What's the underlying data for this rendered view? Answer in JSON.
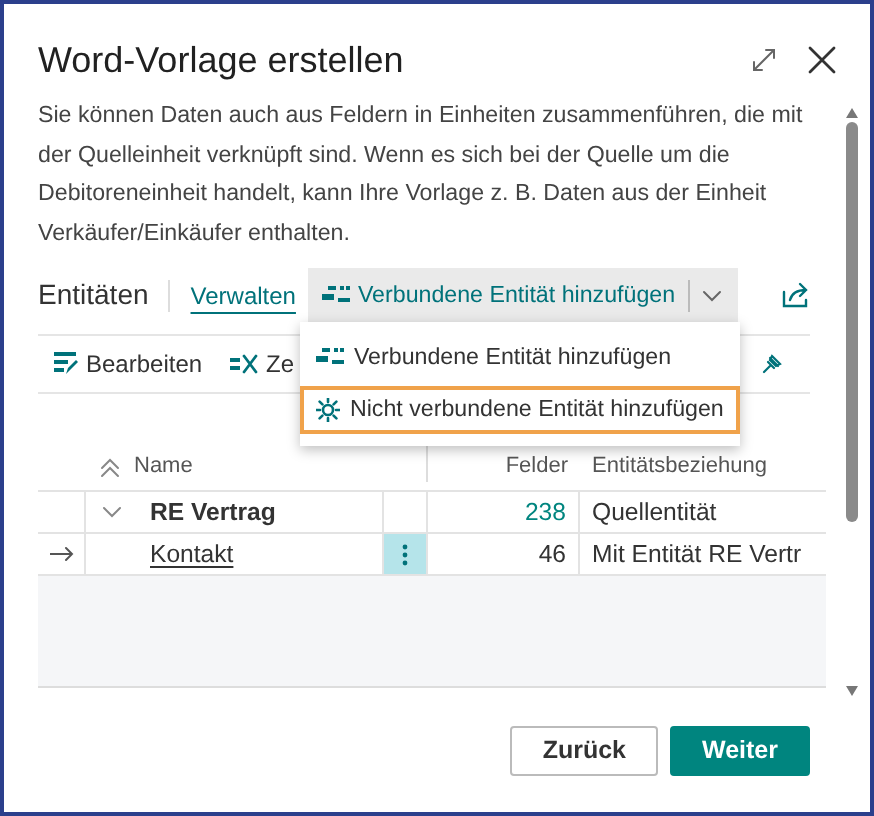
{
  "window": {
    "title": "Word-Vorlage erstellen"
  },
  "description": "Sie können Daten auch aus Feldern in Einheiten zusammenführen, die mit der Quelleinheit verknüpft sind. Wenn es sich bei der Quelle um die Debitoreneinheit handelt, kann Ihre Vorlage z. B. Daten aus der Einheit Verkäufer/Einkäufer enthalten.",
  "entities_bar": {
    "title": "Entitäten",
    "tabs": [
      {
        "label": "Verwalten",
        "selected": true
      }
    ],
    "split_button": {
      "label": "Verbundene Entität hinzufügen",
      "expanded": true
    }
  },
  "actions": [
    {
      "label": "Bearbeiten",
      "kind": "edit"
    },
    {
      "label": "Ze",
      "kind": "remove"
    }
  ],
  "menu": {
    "items": [
      {
        "label": "Verbundene Entität hinzufügen",
        "kind": "linked",
        "selected": false
      },
      {
        "label": "Nicht verbundene Entität hinzufügen",
        "kind": "unlinked",
        "selected": true
      }
    ]
  },
  "table": {
    "columns": [
      "Name",
      "Felder",
      "Entitätsbeziehung"
    ],
    "rows": [
      {
        "name": "RE Vertrag",
        "fields": "238",
        "fields_link": true,
        "relation": "Quellentität",
        "expanded": true,
        "current": false,
        "children": [
          {
            "name": "Kontakt",
            "fields": "46",
            "fields_link": false,
            "relation": "Mit Entität RE Vertr",
            "current": true
          }
        ]
      }
    ]
  },
  "buttons": [
    {
      "label": "Zurück",
      "kind": "secondary"
    },
    {
      "label": "Weiter",
      "kind": "primary"
    }
  ]
}
